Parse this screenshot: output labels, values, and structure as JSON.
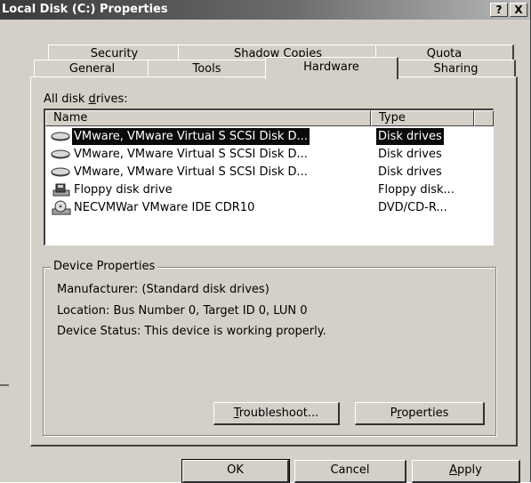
{
  "window": {
    "title": "Local Disk (C:) Properties",
    "help_label": "?",
    "close_label": "X"
  },
  "tabs": {
    "row1": [
      "Security",
      "Shadow Copies",
      "Quota"
    ],
    "row2": [
      "General",
      "Tools",
      "Hardware",
      "Sharing"
    ],
    "active": "Hardware"
  },
  "drives": {
    "label_pre": "All disk ",
    "label_hot": "d",
    "label_post": "rives:",
    "columns": [
      "Name",
      "Type"
    ],
    "rows": [
      {
        "name": "VMware, VMware Virtual S SCSI Disk D...",
        "type": "Disk drives",
        "icon": "hard-disk-icon",
        "selected": true
      },
      {
        "name": "VMware, VMware Virtual S SCSI Disk D...",
        "type": "Disk drives",
        "icon": "hard-disk-icon",
        "selected": false
      },
      {
        "name": "VMware, VMware Virtual S SCSI Disk D...",
        "type": "Disk drives",
        "icon": "hard-disk-icon",
        "selected": false
      },
      {
        "name": "Floppy disk drive",
        "type": "Floppy disk...",
        "icon": "floppy-drive-icon",
        "selected": false
      },
      {
        "name": "NECVMWar VMware IDE CDR10",
        "type": "DVD/CD-R...",
        "icon": "cd-drive-icon",
        "selected": false
      }
    ]
  },
  "device_properties": {
    "legend": "Device Properties",
    "manufacturer": "Manufacturer: (Standard disk drives)",
    "location": "Location: Bus Number 0, Target ID 0, LUN 0",
    "status": "Device Status: This device is working properly.",
    "troubleshoot_hot": "T",
    "troubleshoot_rest": "roubleshoot...",
    "properties_pre": "P",
    "properties_hot": "r",
    "properties_post": "operties"
  },
  "footer": {
    "ok_label": "OK",
    "cancel_label": "Cancel",
    "apply_hot": "A",
    "apply_rest": "pply"
  }
}
